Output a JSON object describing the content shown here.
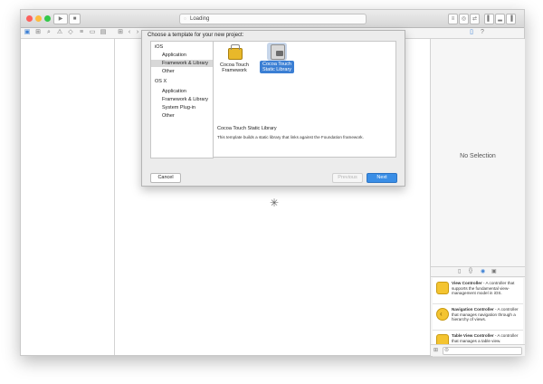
{
  "toolbar": {
    "activity_text": "Loading"
  },
  "sheet": {
    "title": "Choose a template for your new project:",
    "categories": [
      {
        "label": "iOS",
        "type": "header"
      },
      {
        "label": "Application",
        "type": "item"
      },
      {
        "label": "Framework & Library",
        "type": "item",
        "selected": true
      },
      {
        "label": "Other",
        "type": "item"
      },
      {
        "label": "OS X",
        "type": "header"
      },
      {
        "label": "Application",
        "type": "item"
      },
      {
        "label": "Framework & Library",
        "type": "item"
      },
      {
        "label": "System Plug-in",
        "type": "item"
      },
      {
        "label": "Other",
        "type": "item"
      }
    ],
    "templates": [
      {
        "line1": "Cocoa Touch",
        "line2": "Framework",
        "selected": false
      },
      {
        "line1": "Cocoa Touch",
        "line2": "Static Library",
        "selected": true
      }
    ],
    "description_title": "Cocoa Touch Static Library",
    "description_body": "This template builds a static library that links against the Foundation framework.",
    "cancel_label": "Cancel",
    "previous_label": "Previous",
    "next_label": "Next"
  },
  "inspector": {
    "no_selection": "No Selection"
  },
  "library": {
    "items": [
      {
        "name": "View Controller",
        "desc": " - A controller that supports the fundamental view-management model in iOS."
      },
      {
        "name": "Navigation Controller",
        "desc": " - A controller that manages navigation through a hierarchy of views."
      },
      {
        "name": "Table View Controller",
        "desc": " - A controller that manages a table view."
      }
    ]
  },
  "colors": {
    "accent": "#3a8ee6",
    "selection": "#3b7fd4",
    "traffic_close": "#fc605c",
    "traffic_min": "#fdbc40",
    "traffic_max": "#34c84a"
  }
}
